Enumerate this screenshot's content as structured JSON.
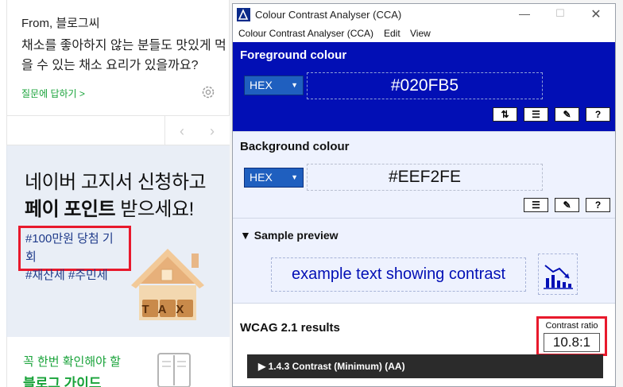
{
  "question": {
    "from": "From, 블로그씨",
    "text": "채소를 좋아하지 않는 분들도 맛있게 먹을 수 있는 채소 요리가 있을까요?",
    "answer_link": "질문에 답하기 >",
    "prev": "‹",
    "next": "›"
  },
  "ad": {
    "line1": "네이버 고지서 신청하고",
    "line2_bold": "페이 포인트",
    "line2_rest": " 받으세요!",
    "tag1": "#100만원 당첨 기회",
    "tag2": "#재산세 #주민세",
    "house_sign": "TAX"
  },
  "guide": {
    "line1": "꼭 한번 확인해야 할",
    "line2": "블로그 가이드"
  },
  "cca": {
    "title": "Colour Contrast Analyser (CCA)",
    "controls": {
      "minimize": "—",
      "maximize": "☐",
      "close": "✕"
    },
    "menu": [
      "Colour Contrast Analyser (CCA)",
      "Edit",
      "View"
    ],
    "foreground": {
      "title": "Foreground colour",
      "format": "HEX",
      "value": "#020FB5",
      "color": "#020fb5",
      "buttons": {
        "swap": "⇅",
        "sliders": "☰",
        "picker": "✎",
        "help": "?"
      }
    },
    "background": {
      "title": "Background colour",
      "format": "HEX",
      "value": "#EEF2FE",
      "color": "#eef2fe",
      "buttons": {
        "sliders": "☰",
        "picker": "✎",
        "help": "?"
      }
    },
    "preview": {
      "title": "▼ Sample preview",
      "sample": "example text showing contrast"
    },
    "wcag": {
      "title": "WCAG 2.1 results",
      "ratio_label": "Contrast ratio",
      "ratio_value": "10.8:1",
      "criterion": "▶  1.4.3 Contrast (Minimum) (AA)"
    }
  }
}
